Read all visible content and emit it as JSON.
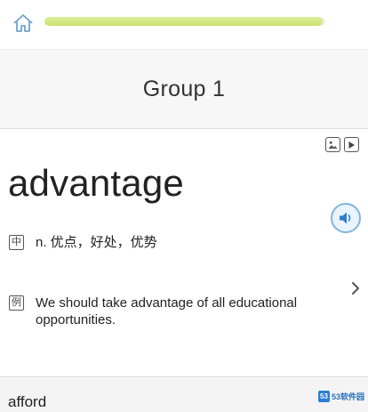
{
  "progress": {
    "fraction": 0.99
  },
  "group": {
    "title": "Group 1"
  },
  "card": {
    "word": "advantage",
    "meaning_icon": "中",
    "meaning": "n. 优点，好处，优势",
    "example_icon": "例",
    "example": "We should take advantage of all educational opportunities."
  },
  "next": {
    "word": "afford"
  },
  "watermark": {
    "logo": "53",
    "text": "53软件园"
  },
  "colors": {
    "progress": "#c9e06a",
    "accent": "#7fb4e0"
  },
  "icons": {
    "home": "home-icon",
    "image": "image-icon",
    "play": "play-icon",
    "speaker": "speaker-icon",
    "chevron": "chevron-right-icon"
  }
}
